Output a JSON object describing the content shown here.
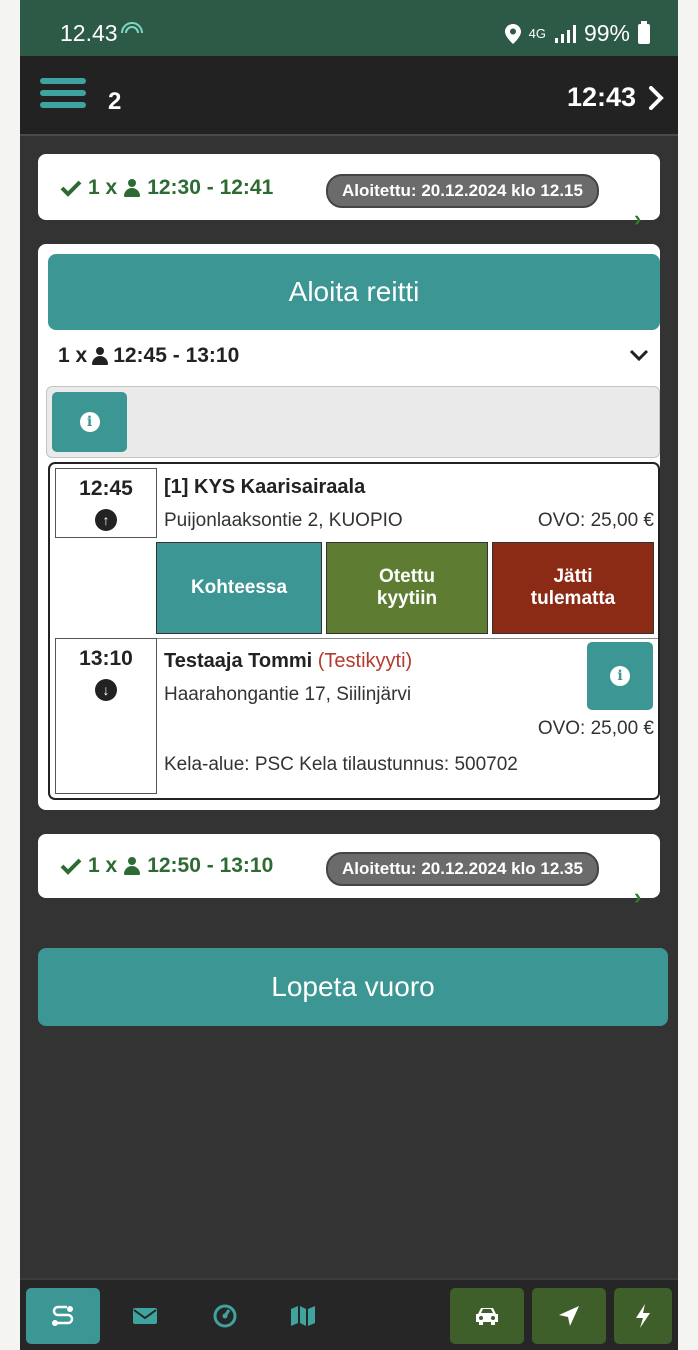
{
  "statusbar": {
    "time": "12.43",
    "signal": "4G",
    "battery": "99%"
  },
  "topbar": {
    "count": "2",
    "clock": "12:43"
  },
  "rides": [
    {
      "summary_count": "1 x",
      "time_range": "12:30 - 12:41",
      "badge": "Aloitettu: 20.12.2024 klo 12.15"
    },
    {
      "summary_count": "1 x",
      "time_range": "12:50 - 13:10",
      "badge": "Aloitettu: 20.12.2024 klo 12.35"
    }
  ],
  "active_ride": {
    "start_button": "Aloita reitti",
    "summary_count": "1 x",
    "time_range": "12:45 - 13:10",
    "stops": [
      {
        "time": "12:45",
        "name": "[1] KYS Kaarisairaala",
        "address": "Puijonlaaksontie 2, KUOPIO",
        "price": "OVO: 25,00 €"
      },
      {
        "time": "13:10",
        "name": "Testaaja Tommi",
        "tag": "(Testikyyti)",
        "address": "Haarahongantie 17, Siilinjärvi",
        "price": "OVO: 25,00 €",
        "extra": "Kela-alue: PSC Kela tilaustunnus: 500702"
      }
    ],
    "actions": {
      "arrived": "Kohteessa",
      "picked_up_l1": "Otettu",
      "picked_up_l2": "kyytiin",
      "no_show_l1": "Jätti",
      "no_show_l2": "tulematta"
    }
  },
  "end_shift_button": "Lopeta vuoro",
  "colors": {
    "teal": "#3c9693",
    "green": "#5e7d32",
    "red": "#8b2b16",
    "status_green": "#2e6b34"
  },
  "nav": {
    "left": [
      "route-icon",
      "mail-icon",
      "dashboard-icon",
      "map-icon"
    ],
    "right": [
      "car-icon",
      "location-arrow-icon",
      "bolt-icon"
    ]
  }
}
